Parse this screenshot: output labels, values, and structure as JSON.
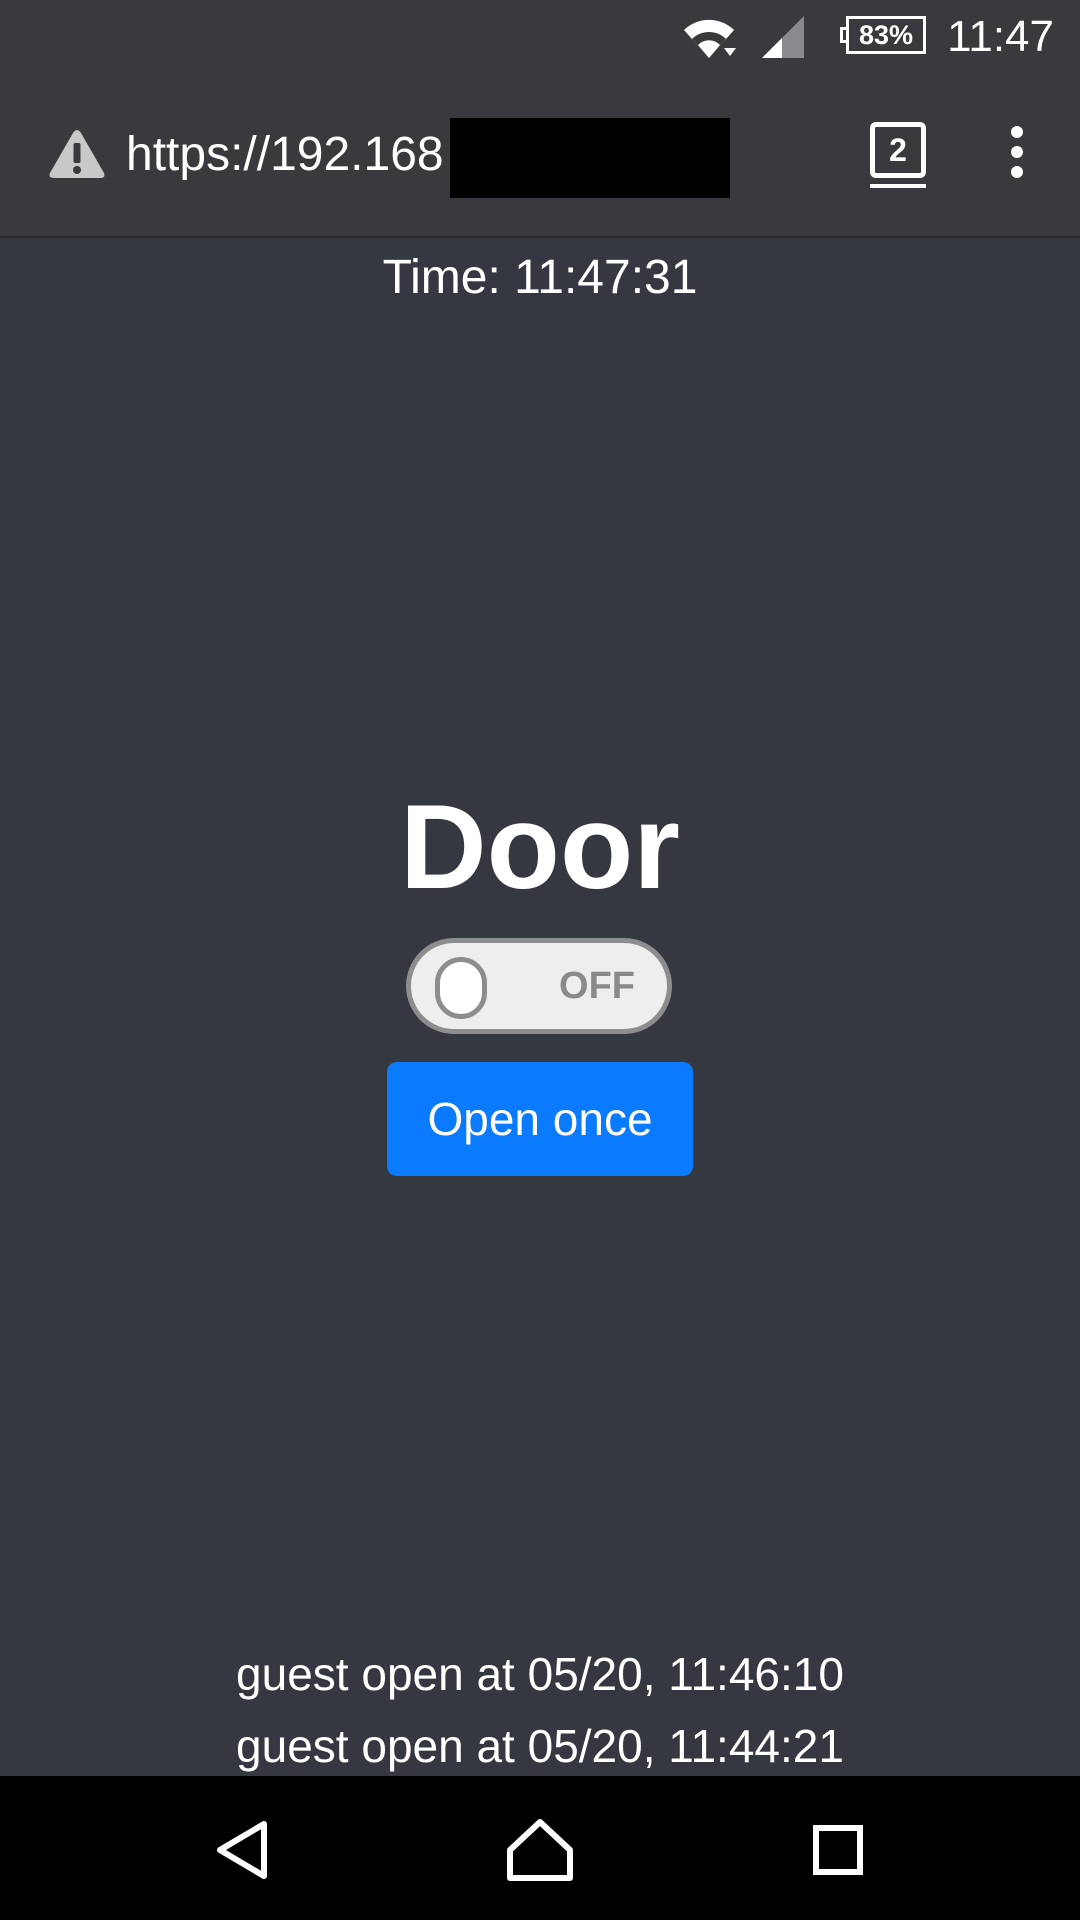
{
  "status_bar": {
    "battery_percent": "83%",
    "clock": "11:47",
    "icons": [
      "wifi-icon",
      "signal-icon",
      "battery-icon"
    ]
  },
  "browser": {
    "url_visible": "https://192.168",
    "tab_count": "2",
    "icons": [
      "warning-icon",
      "tab-switcher-icon",
      "menu-icon"
    ]
  },
  "page": {
    "time_label": "Time: 11:47:31",
    "title": "Door",
    "toggle": {
      "state_label": "OFF",
      "is_on": false
    },
    "open_button_label": "Open once",
    "log": [
      "guest open at 05/20, 11:46:10",
      "guest open at 05/20, 11:44:21"
    ]
  },
  "colors": {
    "background": "#353840",
    "chrome": "#3a3a3e",
    "button_blue": "#0a7bff",
    "toggle_off": "#8d8d8d"
  },
  "nav_bar": {
    "icons": [
      "back-icon",
      "home-icon",
      "recents-icon"
    ]
  }
}
